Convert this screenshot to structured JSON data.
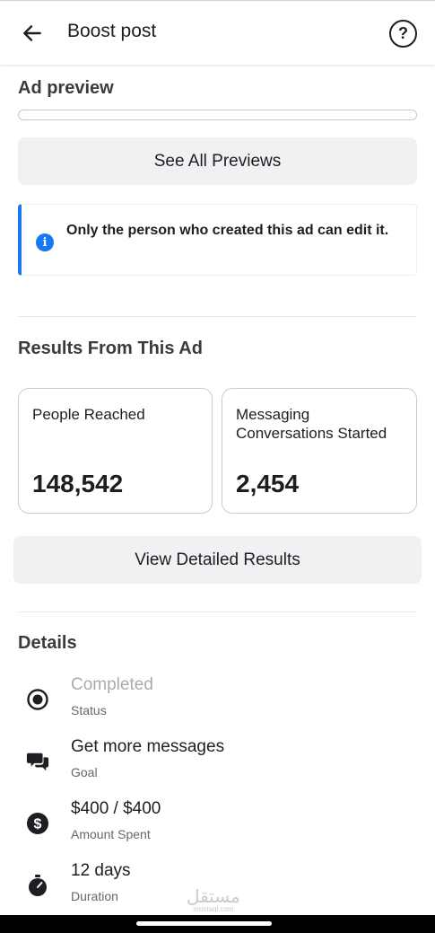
{
  "header": {
    "title": "Boost post",
    "help_glyph": "?"
  },
  "ad_preview": {
    "title": "Ad preview",
    "see_all_label": "See All Previews"
  },
  "notice": {
    "text": "Only the person who created this ad can edit it.",
    "icon_glyph": "i",
    "accent_color": "#1877f2"
  },
  "results": {
    "title": "Results From This Ad",
    "cards": [
      {
        "label": "People Reached",
        "value": "148,542"
      },
      {
        "label": "Messaging Conversations Started",
        "value": "2,454"
      }
    ],
    "view_detailed_label": "View Detailed Results"
  },
  "details": {
    "title": "Details",
    "items": [
      {
        "icon": "radio-target-icon",
        "value": "Completed",
        "label": "Status",
        "muted": true
      },
      {
        "icon": "chat-bubbles-icon",
        "value": "Get more messages",
        "label": "Goal",
        "muted": false
      },
      {
        "icon": "dollar-coin-icon",
        "value": "$400 / $400",
        "label": "Amount Spent",
        "muted": false
      },
      {
        "icon": "stopwatch-icon",
        "value": "12 days",
        "label": "Duration",
        "muted": false
      }
    ]
  },
  "watermark": {
    "arabic": "مستقل",
    "latin": "mostaql.com"
  }
}
